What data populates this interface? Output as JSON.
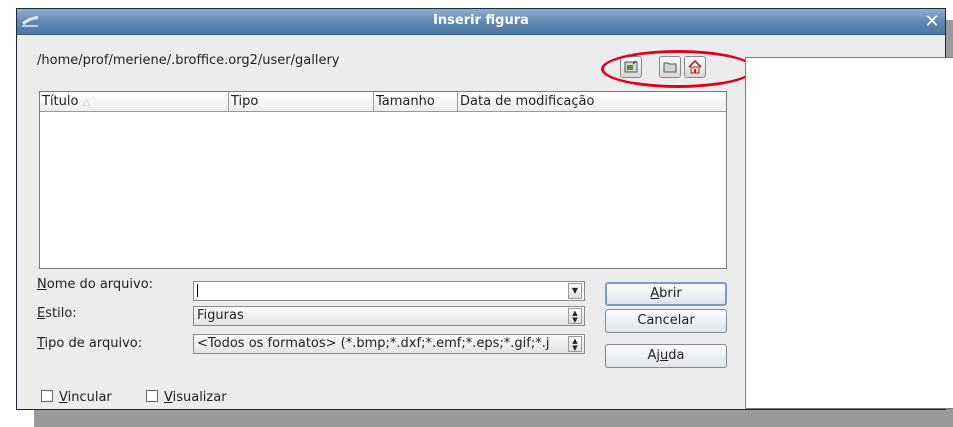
{
  "window": {
    "title": "Inserir figura",
    "close_glyph": "✕"
  },
  "path": "/home/prof/meriene/.broffice.org2/user/gallery",
  "toolbar": {
    "icons": [
      "up-level-icon",
      "new-folder-icon",
      "home-icon"
    ]
  },
  "file_list": {
    "columns": [
      "Título",
      "Tipo",
      "Tamanho",
      "Data de modificação"
    ],
    "sort_indicator": "△"
  },
  "form": {
    "filename": {
      "label_pre": "",
      "label_mnemonic": "N",
      "label_post": "ome do arquivo:",
      "value": ""
    },
    "style": {
      "label_mnemonic": "E",
      "label_post": "stilo:",
      "value": "Figuras"
    },
    "filetype": {
      "label_mnemonic": "T",
      "label_post": "ipo de arquivo:",
      "value": "<Todos os formatos> (*.bmp;*.dxf;*.emf;*.eps;*.gif;*.j"
    }
  },
  "buttons": {
    "open": {
      "pre": "",
      "mnemonic": "A",
      "post": "brir"
    },
    "cancel": "Cancelar",
    "help": {
      "pre": "Aj",
      "mnemonic": "u",
      "post": "da"
    }
  },
  "checkboxes": {
    "link": {
      "mnemonic": "V",
      "post": "incular",
      "checked": false
    },
    "preview": {
      "mnemonic": "V",
      "post": "isualizar",
      "checked": false
    }
  },
  "colors": {
    "titlebar": "#5d87b1",
    "highlight": "#e3001b"
  }
}
